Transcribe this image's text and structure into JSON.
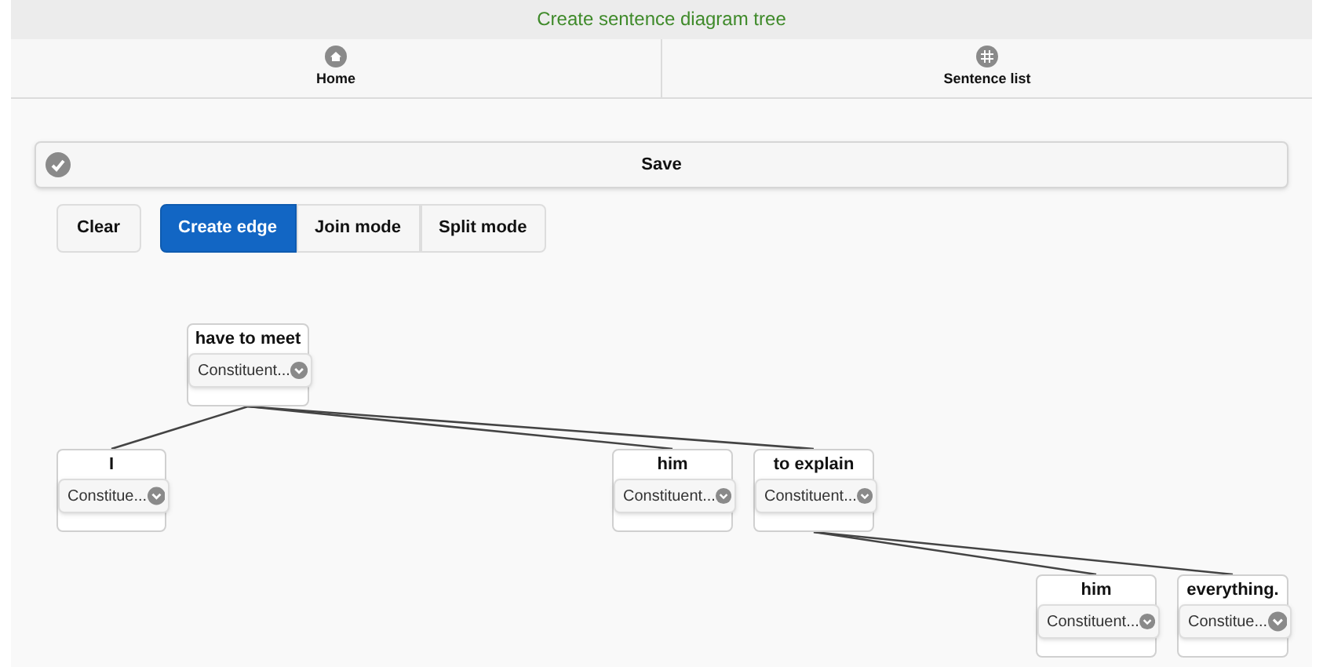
{
  "header": {
    "title": "Create sentence diagram tree"
  },
  "nav": [
    {
      "label": "Home",
      "kind": "home"
    },
    {
      "label": "Sentence list",
      "kind": "grid"
    }
  ],
  "save_button": {
    "label": "Save"
  },
  "toolbar": {
    "clear": "Clear",
    "modes": [
      {
        "label": "Create edge",
        "selected": true
      },
      {
        "label": "Join mode",
        "selected": false
      },
      {
        "label": "Split mode",
        "selected": false
      }
    ]
  },
  "tree": {
    "label": "have to meet",
    "select": "Constituent...",
    "children": [
      {
        "label": "I",
        "select": "Constitue..."
      },
      {
        "label": "him",
        "select": "Constituent..."
      },
      {
        "label": "to explain",
        "select": "Constituent...",
        "children": [
          {
            "label": "him",
            "select": "Constituent..."
          },
          {
            "label": "everything.",
            "select": "Constitue..."
          }
        ]
      }
    ]
  }
}
